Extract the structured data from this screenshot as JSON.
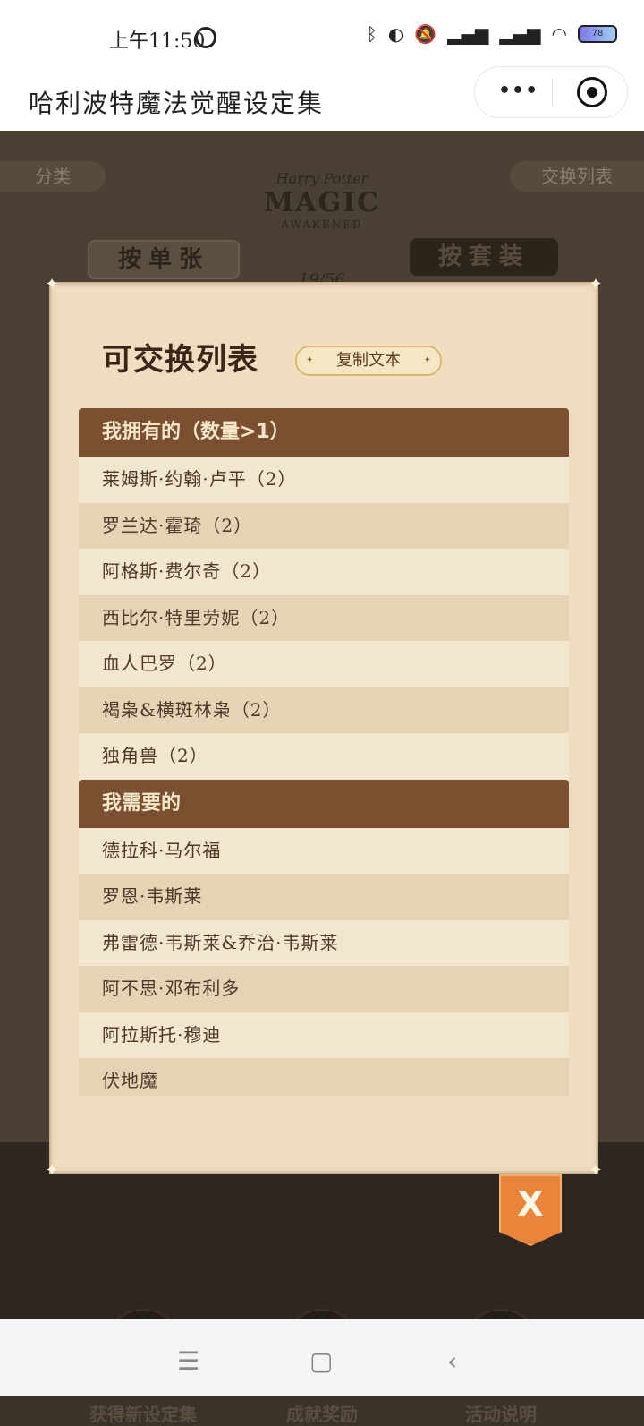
{
  "status": {
    "time": "上午11:50",
    "battery": "78"
  },
  "header": {
    "title": "哈利波特魔法觉醒设定集",
    "menu_glyph": "•••"
  },
  "game": {
    "tab_left": "分类",
    "tab_right": "交换列表",
    "logo_line1": "Harry Potter",
    "logo_line2": "MAGIC",
    "logo_line3": "AWAKENED",
    "btn_single": "按单张",
    "btn_set": "按套装",
    "count": "19/56",
    "bottom_nav": [
      {
        "label": "获得新设定集"
      },
      {
        "label": "成就奖励"
      },
      {
        "label": "活动说明"
      }
    ]
  },
  "modal": {
    "title": "可交换列表",
    "copy_label": "复制文本",
    "close_label": "X",
    "owned_heading": "我拥有的（数量>1）",
    "owned": [
      "莱姆斯·约翰·卢平（2）",
      "罗兰达·霍琦（2）",
      "阿格斯·费尔奇（2）",
      "西比尔·特里劳妮（2）",
      "血人巴罗（2）",
      "褐枭&横斑林枭（2）",
      "独角兽（2）"
    ],
    "need_heading": "我需要的",
    "need": [
      "德拉科·马尔福",
      "罗恩·韦斯莱",
      "弗雷德·韦斯莱&乔治·韦斯莱",
      "阿不思·邓布利多",
      "阿拉斯托·穆迪",
      "伏地魔"
    ]
  },
  "colors": {
    "modal_bg": "#f0dcc0",
    "section_header": "#7b5030",
    "close_badge": "#e9843a"
  }
}
